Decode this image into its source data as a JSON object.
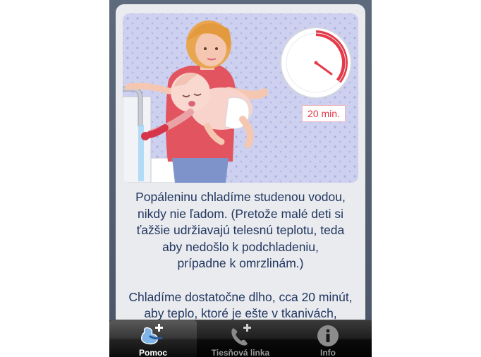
{
  "timer": {
    "label": "20 min."
  },
  "content": {
    "paragraph1": "Popáleninu chladíme studenou vodou,\nnikdy nie ľadom. (Pretože malé deti si\nťažšie udržiavajú telesnú teplotu, teda\naby nedošlo k podchladeniu,\nprípadne k omrzlinám.)",
    "paragraph2": "Chladíme dostatočne dlho, cca 20 minút,\naby teplo, ktoré je ešte v tkanivách,"
  },
  "tabbar": {
    "tabs": [
      {
        "label": "Pomoc",
        "icon": "first-aid-icon",
        "active": true
      },
      {
        "label": "Tiesňová linka",
        "icon": "phone-plus-icon",
        "active": false
      },
      {
        "label": "Info",
        "icon": "info-icon",
        "active": false
      }
    ]
  },
  "colors": {
    "accent_red": "#e53a4a",
    "text_navy": "#223660",
    "illustration_bg": "#cdd0ef"
  }
}
